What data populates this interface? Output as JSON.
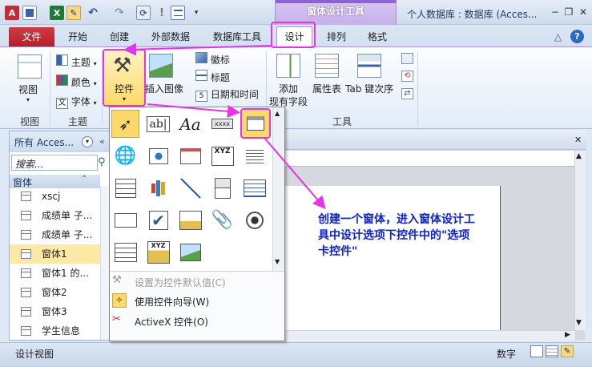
{
  "window": {
    "title": "个人数据库 : 数据库 (Acces...",
    "context_tools": "窗体设计工具"
  },
  "tabs": {
    "file": "文件",
    "home": "开始",
    "create": "创建",
    "external": "外部数据",
    "dbtools": "数据库工具",
    "design": "设计",
    "arrange": "排列",
    "format": "格式"
  },
  "ribbon": {
    "view": {
      "label": "视图",
      "group": "视图"
    },
    "theme": {
      "theme": "主题",
      "color": "颜色",
      "font": "字体",
      "group": "主题"
    },
    "controls": {
      "label": "控件"
    },
    "insert_image": {
      "label": "插入图像"
    },
    "header": {
      "logo": "徽标",
      "title": "标题",
      "datetime": "日期和时间"
    },
    "tools": {
      "add_fields_1": "添加",
      "add_fields_2": "现有字段",
      "property_sheet": "属性表",
      "tab_order": "Tab 键次序",
      "group": "工具"
    }
  },
  "nav": {
    "title": "所有 Acces...",
    "search_placeholder": "搜索...",
    "group": "窗体",
    "items": [
      "xscj",
      "成绩单 子...",
      "成绩单 子...",
      "窗体1",
      "窗体1 的...",
      "窗体2",
      "窗体3",
      "学生信息"
    ],
    "selected_index": 3
  },
  "gallery": {
    "textbox": "ab|",
    "label": "Aa",
    "button": "xxxx",
    "xyz": "XYZ",
    "commands": {
      "set_default": "设置为控件默认值(C)",
      "use_wizard": "使用控件向导(W)",
      "activex": "ActiveX 控件(O)"
    }
  },
  "annotation": "创建一个窗体，进入窗体设计工具中设计选项下控件中的\"选项卡控件\"",
  "status": {
    "left": "设计视图",
    "right": "数字"
  },
  "colors": {
    "accent": "#e533e5",
    "file_tab": "#c42b34",
    "context": "#8c63d6",
    "annotation": "#0b1fd8"
  }
}
